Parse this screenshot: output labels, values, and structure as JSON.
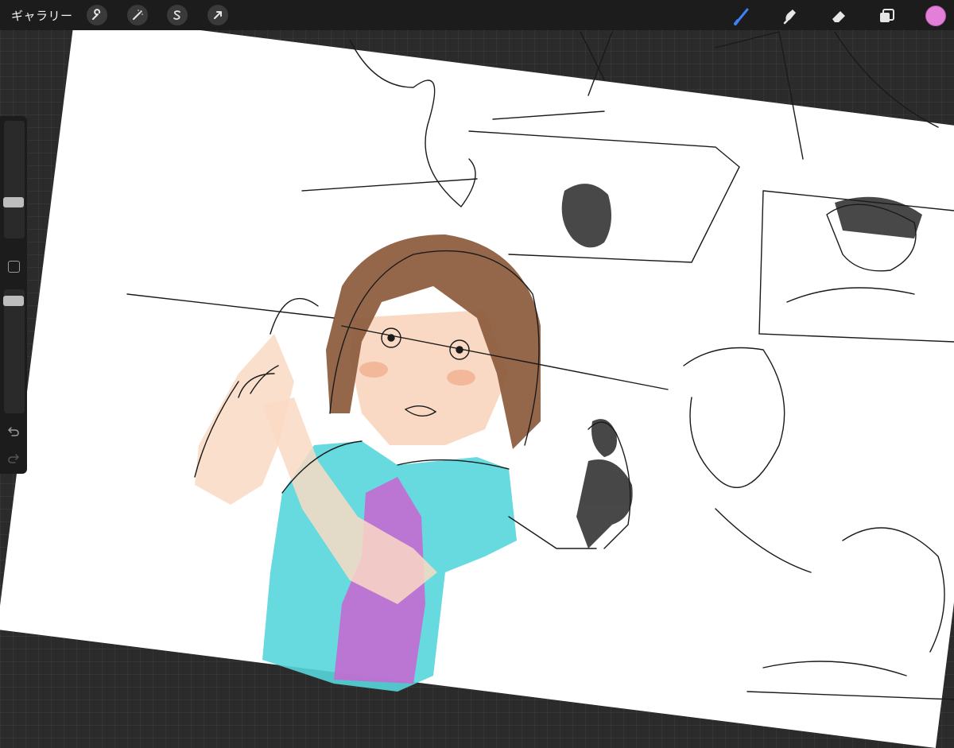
{
  "topbar": {
    "gallery_label": "ギャラリー",
    "left_tools": [
      {
        "name": "actions",
        "icon": "wrench-icon"
      },
      {
        "name": "adjustments",
        "icon": "magic-wand-icon"
      },
      {
        "name": "selection",
        "icon": "selection-s-icon"
      },
      {
        "name": "transform",
        "icon": "arrow-cursor-icon"
      }
    ],
    "right_tools": [
      {
        "name": "brush",
        "icon": "brush-icon",
        "active": true
      },
      {
        "name": "smudge",
        "icon": "smudge-icon",
        "active": false
      },
      {
        "name": "eraser",
        "icon": "eraser-icon",
        "active": false
      },
      {
        "name": "layers",
        "icon": "layers-icon",
        "active": false
      }
    ],
    "active_tool_color": "#3b82f6",
    "current_color": "#e47fd9"
  },
  "sidebar": {
    "brush_size_level": 0.7,
    "opacity_level": 0.93,
    "undo_icon": "undo-icon",
    "redo_icon": "redo-icon",
    "modify_icon": "square-icon"
  },
  "artwork": {
    "subject": "sketch",
    "colors": {
      "hair": "#8b5a3c",
      "skin": "#fad9c4",
      "jacket": "#55d6dc",
      "shirt": "#c46ad3",
      "lines": "#1a1a1a"
    }
  }
}
